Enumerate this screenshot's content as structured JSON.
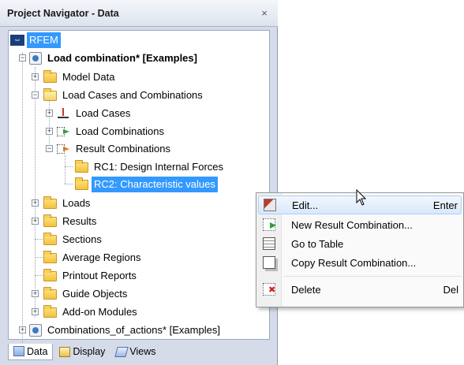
{
  "panel": {
    "title": "Project Navigator - Data",
    "close_glyph": "×"
  },
  "tree": {
    "root": "RFEM",
    "items": [
      {
        "label": "Load combination* [Examples]"
      },
      {
        "label": "Model Data"
      },
      {
        "label": "Load Cases and Combinations"
      },
      {
        "label": "Load Cases"
      },
      {
        "label": "Load Combinations"
      },
      {
        "label": "Result Combinations"
      },
      {
        "label": "RC1: Design Internal Forces"
      },
      {
        "label": "RC2: Characteristic values"
      },
      {
        "label": "Loads"
      },
      {
        "label": "Results"
      },
      {
        "label": "Sections"
      },
      {
        "label": "Average Regions"
      },
      {
        "label": "Printout Reports"
      },
      {
        "label": "Guide Objects"
      },
      {
        "label": "Add-on Modules"
      },
      {
        "label": "Combinations_of_actions* [Examples]"
      }
    ]
  },
  "tabs": [
    {
      "label": "Data",
      "icon": "data-icon"
    },
    {
      "label": "Display",
      "icon": "display-icon"
    },
    {
      "label": "Views",
      "icon": "views-icon"
    }
  ],
  "context_menu": {
    "items": [
      {
        "label": "Edit...",
        "shortcut": "Enter",
        "icon": "edit-icon"
      },
      {
        "label": "New Result Combination...",
        "shortcut": "",
        "icon": "new-result-combination-icon"
      },
      {
        "label": "Go to Table",
        "shortcut": "",
        "icon": "table-icon"
      },
      {
        "label": "Copy Result Combination...",
        "shortcut": "",
        "icon": "copy-icon"
      },
      {
        "label": "Delete",
        "shortcut": "Del",
        "icon": "delete-icon"
      }
    ]
  },
  "colors": {
    "selection": "#3399ff",
    "panel_bg": "#d6dbe9",
    "menu_hover": "#d9e8fb"
  }
}
